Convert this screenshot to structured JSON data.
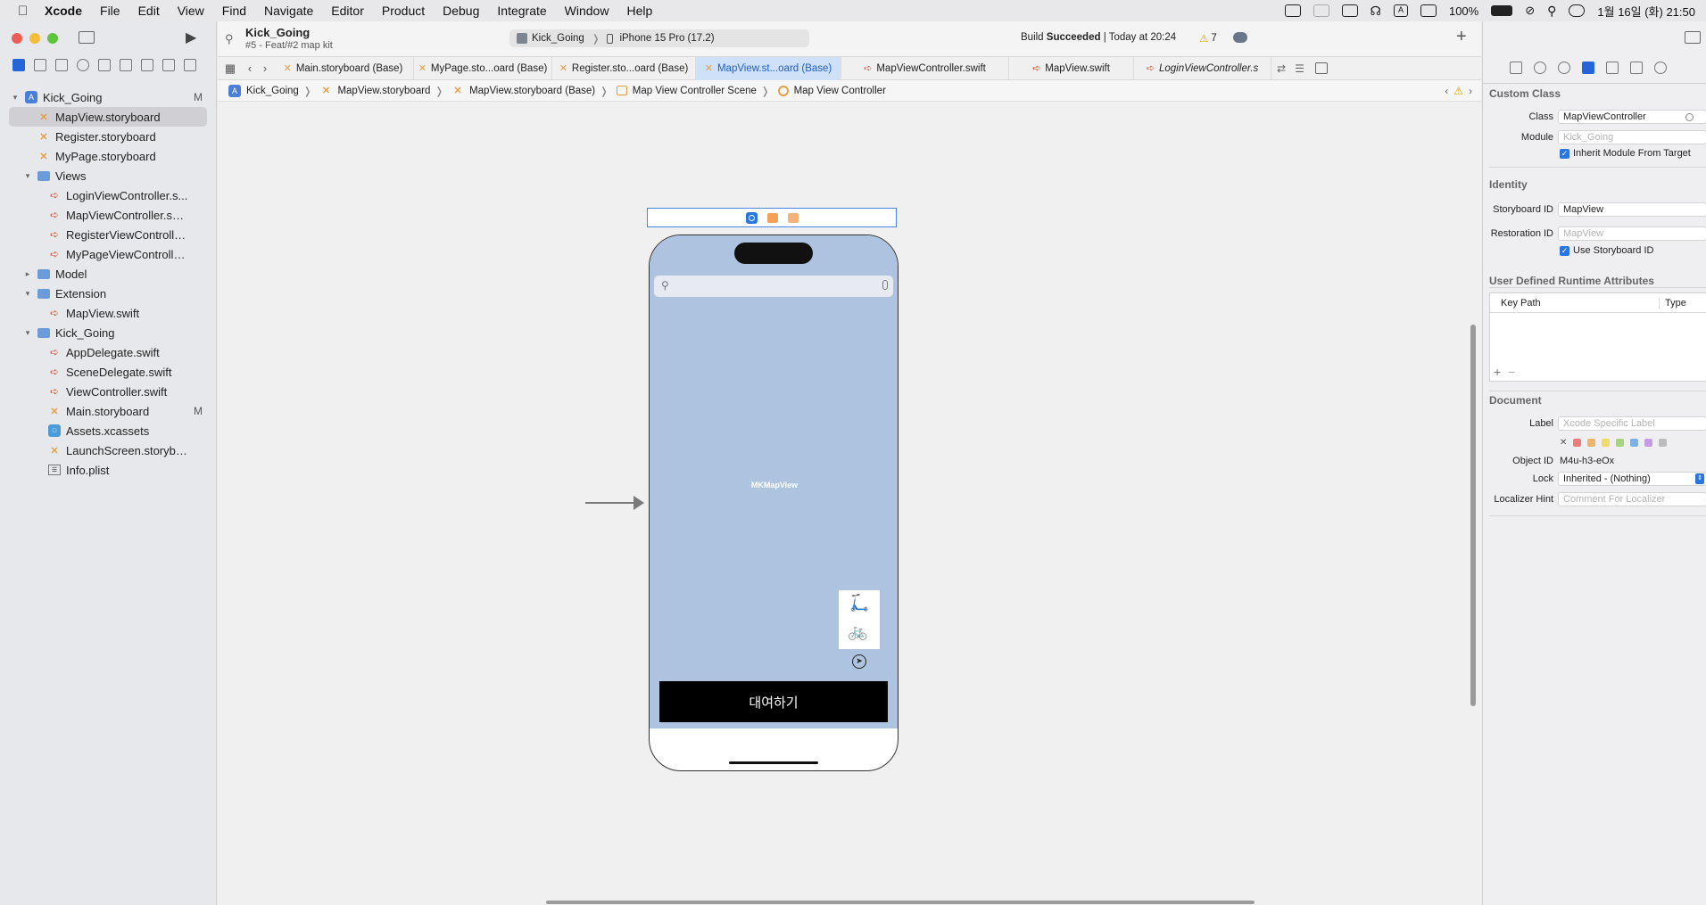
{
  "menubar": {
    "app_name": "Xcode",
    "items": [
      "File",
      "Edit",
      "View",
      "Find",
      "Navigate",
      "Editor",
      "Product",
      "Debug",
      "Integrate",
      "Window",
      "Help"
    ],
    "battery": "100%",
    "clock": "1월 16일 (화) 21:50"
  },
  "project": {
    "name": "Kick_Going",
    "branch": "#5 - Feat/#2 map kit",
    "scheme": "Kick_Going",
    "device": "iPhone 15 Pro (17.2)",
    "build_status_prefix": "Build",
    "build_status_bold": "Succeeded",
    "build_time": "| Today at 20:24",
    "warning_count": "7"
  },
  "navigator": {
    "items": [
      {
        "label": "Kick_Going",
        "kind": "proj",
        "badge": "M",
        "level": 0,
        "disclosure": "▾"
      },
      {
        "label": "MapView.storyboard",
        "kind": "sb",
        "badge": "",
        "level": 1,
        "selected": true
      },
      {
        "label": "Register.storyboard",
        "kind": "sb",
        "badge": "",
        "level": 1
      },
      {
        "label": "MyPage.storyboard",
        "kind": "sb",
        "badge": "",
        "level": 1
      },
      {
        "label": "Views",
        "kind": "folder",
        "badge": "",
        "level": 1,
        "disclosure": "▾"
      },
      {
        "label": "LoginViewController.s...",
        "kind": "swift",
        "badge": "",
        "level": 2
      },
      {
        "label": "MapViewController.swift",
        "kind": "swift",
        "badge": "",
        "level": 2
      },
      {
        "label": "RegisterViewControlle...",
        "kind": "swift",
        "badge": "",
        "level": 2
      },
      {
        "label": "MyPageViewController...",
        "kind": "swift",
        "badge": "",
        "level": 2
      },
      {
        "label": "Model",
        "kind": "folder",
        "badge": "",
        "level": 1,
        "disclosure": "▸"
      },
      {
        "label": "Extension",
        "kind": "folder",
        "badge": "",
        "level": 1,
        "disclosure": "▾"
      },
      {
        "label": "MapView.swift",
        "kind": "swift",
        "badge": "",
        "level": 2
      },
      {
        "label": "Kick_Going",
        "kind": "folder",
        "badge": "",
        "level": 1,
        "disclosure": "▾"
      },
      {
        "label": "AppDelegate.swift",
        "kind": "swift",
        "badge": "",
        "level": 2
      },
      {
        "label": "SceneDelegate.swift",
        "kind": "swift",
        "badge": "",
        "level": 2
      },
      {
        "label": "ViewController.swift",
        "kind": "swift",
        "badge": "",
        "level": 2
      },
      {
        "label": "Main.storyboard",
        "kind": "sb",
        "badge": "M",
        "level": 2
      },
      {
        "label": "Assets.xcassets",
        "kind": "assets",
        "badge": "",
        "level": 2
      },
      {
        "label": "LaunchScreen.storybo...",
        "kind": "sb",
        "badge": "",
        "level": 2
      },
      {
        "label": "Info.plist",
        "kind": "plist",
        "badge": "",
        "level": 2
      }
    ]
  },
  "tabs": [
    {
      "label": "Main.storyboard (Base)",
      "kind": "sb"
    },
    {
      "label": "MyPage.sto...oard (Base)",
      "kind": "sb"
    },
    {
      "label": "Register.sto...oard (Base)",
      "kind": "sb"
    },
    {
      "label": "MapView.st...oard (Base)",
      "kind": "sb",
      "active": true
    },
    {
      "label": "MapViewController.swift",
      "kind": "swift"
    },
    {
      "label": "MapView.swift",
      "kind": "swift"
    },
    {
      "label": "LoginViewController.s",
      "kind": "swift",
      "italic": true
    }
  ],
  "breadcrumb": [
    "Kick_Going",
    "MapView.storyboard",
    "MapView.storyboard (Base)",
    "Map View Controller Scene",
    "Map View Controller"
  ],
  "scene": {
    "map_label": "MKMapView",
    "rent_button": "대여하기"
  },
  "inspector": {
    "custom_class": {
      "title": "Custom Class",
      "class_label": "Class",
      "class_value": "MapViewController",
      "module_label": "Module",
      "module_placeholder": "Kick_Going",
      "inherit_label": "Inherit Module From Target"
    },
    "identity": {
      "title": "Identity",
      "storyboard_id_label": "Storyboard ID",
      "storyboard_id_value": "MapView",
      "restoration_id_label": "Restoration ID",
      "restoration_id_placeholder": "MapView",
      "use_storyboard_id_label": "Use Storyboard ID"
    },
    "runtime": {
      "title": "User Defined Runtime Attributes",
      "col_key_path": "Key Path",
      "col_type": "Type"
    },
    "document": {
      "title": "Document",
      "label_label": "Label",
      "label_placeholder": "Xcode Specific Label",
      "object_id_label": "Object ID",
      "object_id_value": "M4u-h3-eOx",
      "lock_label": "Lock",
      "lock_value": "Inherited - (Nothing)",
      "localizer_label": "Localizer Hint",
      "localizer_placeholder": "Comment For Localizer",
      "label_colors": [
        "#f07b7b",
        "#f0b36a",
        "#f0dc6a",
        "#a3d67a",
        "#78b1ef",
        "#c79be8",
        "#bbbbbb"
      ]
    }
  }
}
